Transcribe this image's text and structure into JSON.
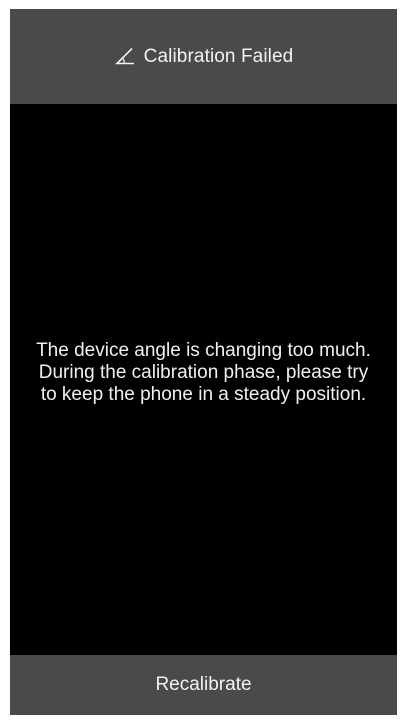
{
  "header": {
    "icon": "angle-icon",
    "title": "Calibration Failed"
  },
  "content": {
    "message": "The device angle is changing too much. During the calibration phase, please try to keep the phone in a steady position."
  },
  "footer": {
    "button_label": "Recalibrate"
  },
  "colors": {
    "bar_background": "#4a4a4a",
    "screen_background": "#000000",
    "text": "#f2f2f2"
  }
}
